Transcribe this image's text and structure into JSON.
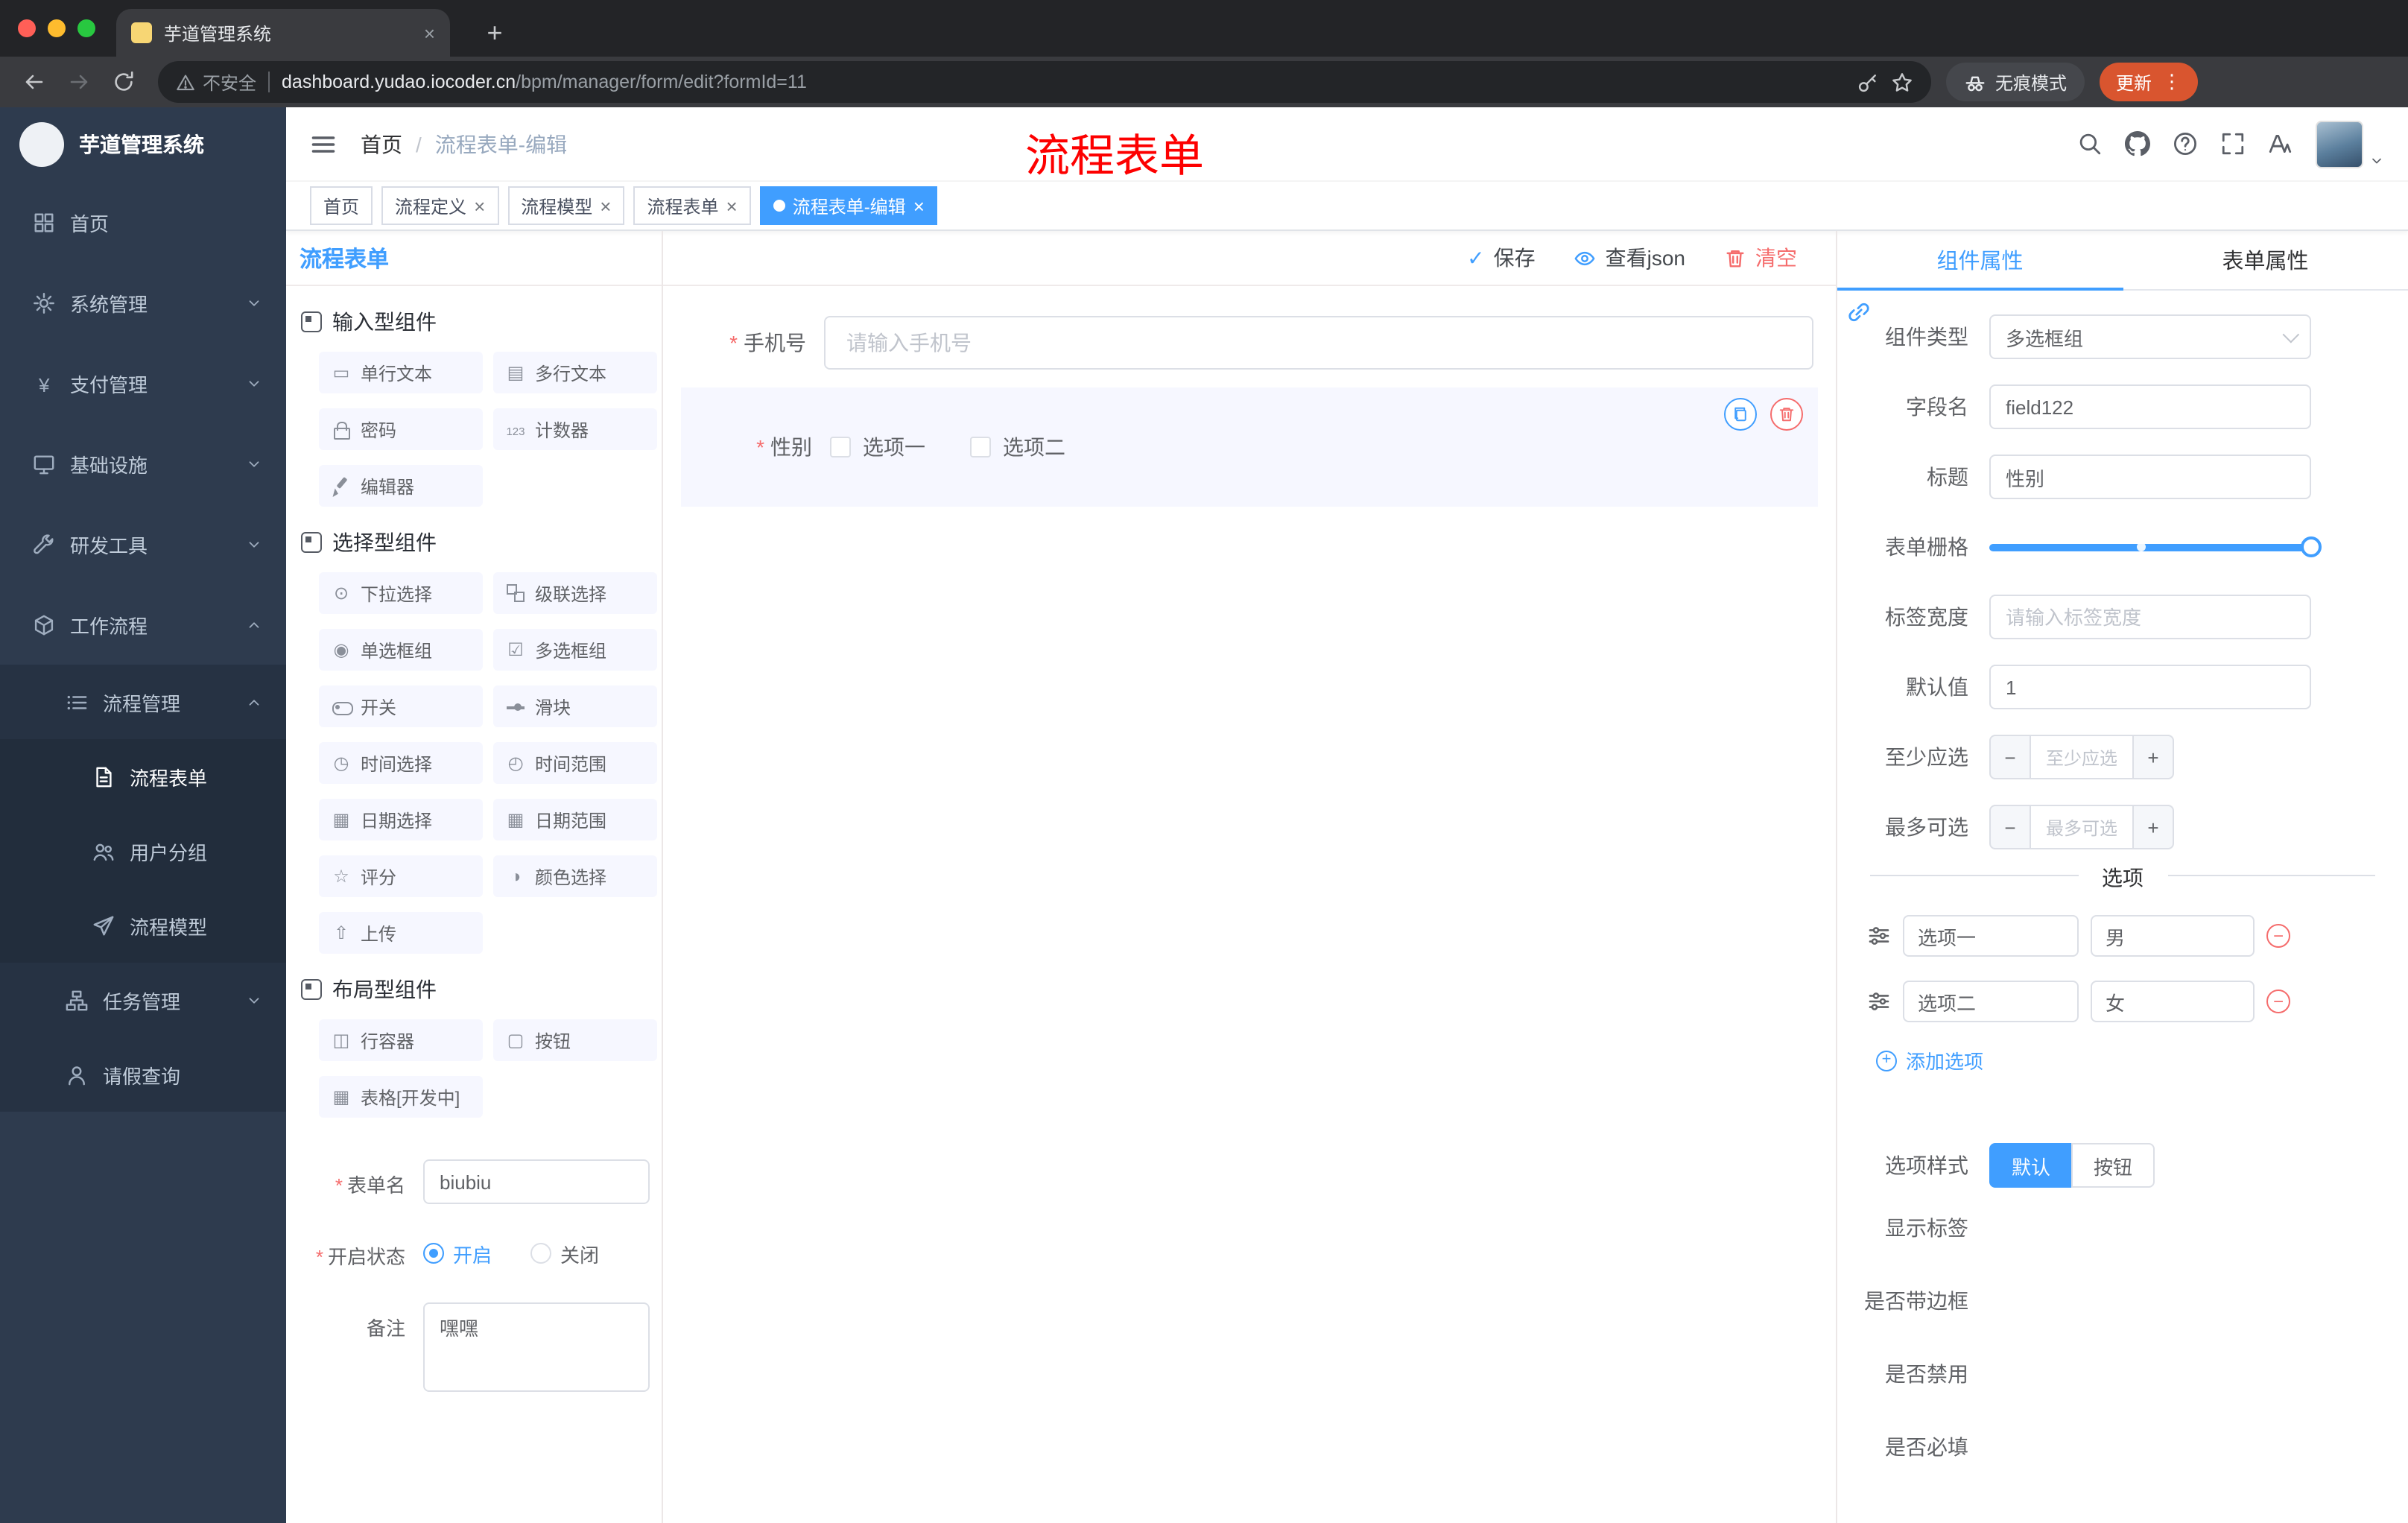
{
  "browser": {
    "tab_title": "芋道管理系统",
    "security_label": "不安全",
    "url_host": "dashboard.yudao.iocoder.cn",
    "url_path": "/bpm/manager/form/edit?formId=11",
    "incognito_label": "无痕模式",
    "update_label": "更新"
  },
  "sidebar": {
    "logo_title": "芋道管理系统",
    "items": [
      {
        "label": "首页",
        "icon": "dashboard-icon"
      },
      {
        "label": "系统管理",
        "icon": "gear-icon"
      },
      {
        "label": "支付管理",
        "icon": "yen-icon"
      },
      {
        "label": "基础设施",
        "icon": "monitor-icon"
      },
      {
        "label": "研发工具",
        "icon": "wrench-icon"
      },
      {
        "label": "工作流程",
        "icon": "cube-icon"
      },
      {
        "label": "流程管理",
        "icon": "list-icon"
      },
      {
        "label": "流程表单",
        "icon": "document-icon"
      },
      {
        "label": "用户分组",
        "icon": "users-icon"
      },
      {
        "label": "流程模型",
        "icon": "send-icon"
      },
      {
        "label": "任务管理",
        "icon": "tree-icon"
      },
      {
        "label": "请假查询",
        "icon": "user-icon"
      }
    ]
  },
  "header": {
    "breadcrumb_home": "首页",
    "breadcrumb_sep": "/",
    "breadcrumb_current": "流程表单-编辑",
    "annotation": "流程表单"
  },
  "tags": [
    {
      "label": "首页"
    },
    {
      "label": "流程定义"
    },
    {
      "label": "流程模型"
    },
    {
      "label": "流程表单"
    },
    {
      "label": "流程表单-编辑"
    }
  ],
  "palette": {
    "title": "流程表单",
    "sections": [
      {
        "title": "输入型组件",
        "items": [
          {
            "label": "单行文本",
            "icon": "single-line-text-icon"
          },
          {
            "label": "多行文本",
            "icon": "textarea-icon"
          },
          {
            "label": "密码",
            "icon": "password-icon"
          },
          {
            "label": "计数器",
            "icon": "counter-icon"
          },
          {
            "label": "编辑器",
            "icon": "editor-icon"
          }
        ]
      },
      {
        "title": "选择型组件",
        "items": [
          {
            "label": "下拉选择",
            "icon": "select-icon"
          },
          {
            "label": "级联选择",
            "icon": "cascader-icon"
          },
          {
            "label": "单选框组",
            "icon": "radio-icon"
          },
          {
            "label": "多选框组",
            "icon": "checkbox-icon"
          },
          {
            "label": "开关",
            "icon": "switch-icon"
          },
          {
            "label": "滑块",
            "icon": "slider-icon"
          },
          {
            "label": "时间选择",
            "icon": "time-icon"
          },
          {
            "label": "时间范围",
            "icon": "time-range-icon"
          },
          {
            "label": "日期选择",
            "icon": "date-icon"
          },
          {
            "label": "日期范围",
            "icon": "date-range-icon"
          },
          {
            "label": "评分",
            "icon": "rate-icon"
          },
          {
            "label": "颜色选择",
            "icon": "color-icon"
          },
          {
            "label": "上传",
            "icon": "upload-icon"
          }
        ]
      },
      {
        "title": "布局型组件",
        "items": [
          {
            "label": "行容器",
            "icon": "row-icon"
          },
          {
            "label": "按钮",
            "icon": "button-icon"
          },
          {
            "label": "表格[开发中]",
            "icon": "table-icon"
          }
        ]
      }
    ],
    "form": {
      "name_label": "表单名",
      "name_value": "biubiu",
      "status_label": "开启状态",
      "status_on": "开启",
      "status_off": "关闭",
      "remark_label": "备注",
      "remark_value": "嘿嘿"
    }
  },
  "canvas": {
    "save": "保存",
    "view_json": "查看json",
    "clear": "清空",
    "phone_label": "手机号",
    "phone_placeholder": "请输入手机号",
    "gender_label": "性别",
    "gender_opt1": "选项一",
    "gender_opt2": "选项二"
  },
  "props": {
    "tab_component": "组件属性",
    "tab_form": "表单属性",
    "type_label": "组件类型",
    "type_value": "多选框组",
    "field_label": "字段名",
    "field_value": "field122",
    "title_label": "标题",
    "title_value": "性别",
    "grid_label": "表单栅格",
    "width_label": "标签宽度",
    "width_placeholder": "请输入标签宽度",
    "default_label": "默认值",
    "default_value": "1",
    "min_label": "至少应选",
    "min_placeholder": "至少应选",
    "max_label": "最多可选",
    "max_placeholder": "最多可选",
    "options_title": "选项",
    "options": [
      {
        "label": "选项一",
        "value": "男"
      },
      {
        "label": "选项二",
        "value": "女"
      }
    ],
    "add_option": "添加选项",
    "style_label": "选项样式",
    "style_default": "默认",
    "style_button": "按钮",
    "show_label": "显示标签",
    "border_label": "是否带边框",
    "disabled_label": "是否禁用",
    "required_label": "是否必填"
  },
  "colors": {
    "accent": "#409eff",
    "danger": "#f56c6c",
    "annotation": "#ff0000"
  }
}
